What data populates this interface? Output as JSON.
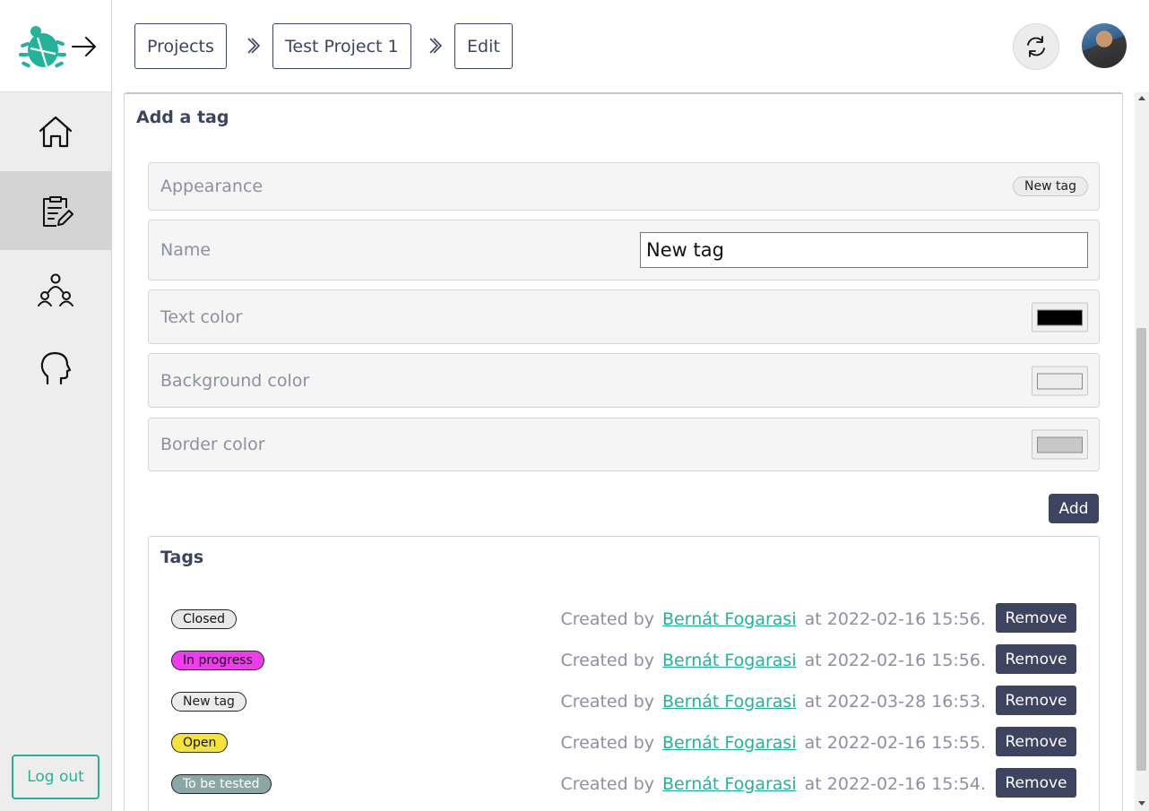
{
  "breadcrumbs": [
    {
      "label": "Projects"
    },
    {
      "label": "Test Project 1"
    },
    {
      "label": "Edit"
    }
  ],
  "sidebar": {
    "logout_label": "Log out",
    "items": [
      {
        "icon": "home-icon"
      },
      {
        "icon": "clipboard-edit-icon"
      },
      {
        "icon": "users-icon"
      },
      {
        "icon": "head-icon"
      }
    ]
  },
  "form": {
    "title": "Add a tag",
    "appearance_label": "Appearance",
    "appearance_preview": "New tag",
    "name_label": "Name",
    "name_value": "New tag",
    "text_color_label": "Text color",
    "text_color": "#000000",
    "background_color_label": "Background color",
    "background_color": "#ececec",
    "border_color_label": "Border color",
    "border_color": "#c8c8c8",
    "add_label": "Add"
  },
  "tags": {
    "title": "Tags",
    "created_by_prefix": "Created by",
    "remove_label": "Remove",
    "items": [
      {
        "name": "Closed",
        "bg": "#e8e8e8",
        "fg": "#111111",
        "author": "Bernát Fogarasi",
        "time": "at 2022-02-16 15:56."
      },
      {
        "name": "In progress",
        "bg": "#ee3cee",
        "fg": "#111111",
        "author": "Bernát Fogarasi",
        "time": "at 2022-02-16 15:56."
      },
      {
        "name": "New tag",
        "bg": "#ececec",
        "fg": "#222222",
        "author": "Bernát Fogarasi",
        "time": "at 2022-03-28 16:53."
      },
      {
        "name": "Open",
        "bg": "#f5e23a",
        "fg": "#111111",
        "author": "Bernát Fogarasi",
        "time": "at 2022-02-16 15:55."
      },
      {
        "name": "To be tested",
        "bg": "#8aa7a6",
        "fg": "#ffffff",
        "author": "Bernát Fogarasi",
        "time": "at 2022-02-16 15:54."
      }
    ]
  },
  "colors": {
    "accent": "#22b39a",
    "primary_dark": "#3d4460"
  }
}
